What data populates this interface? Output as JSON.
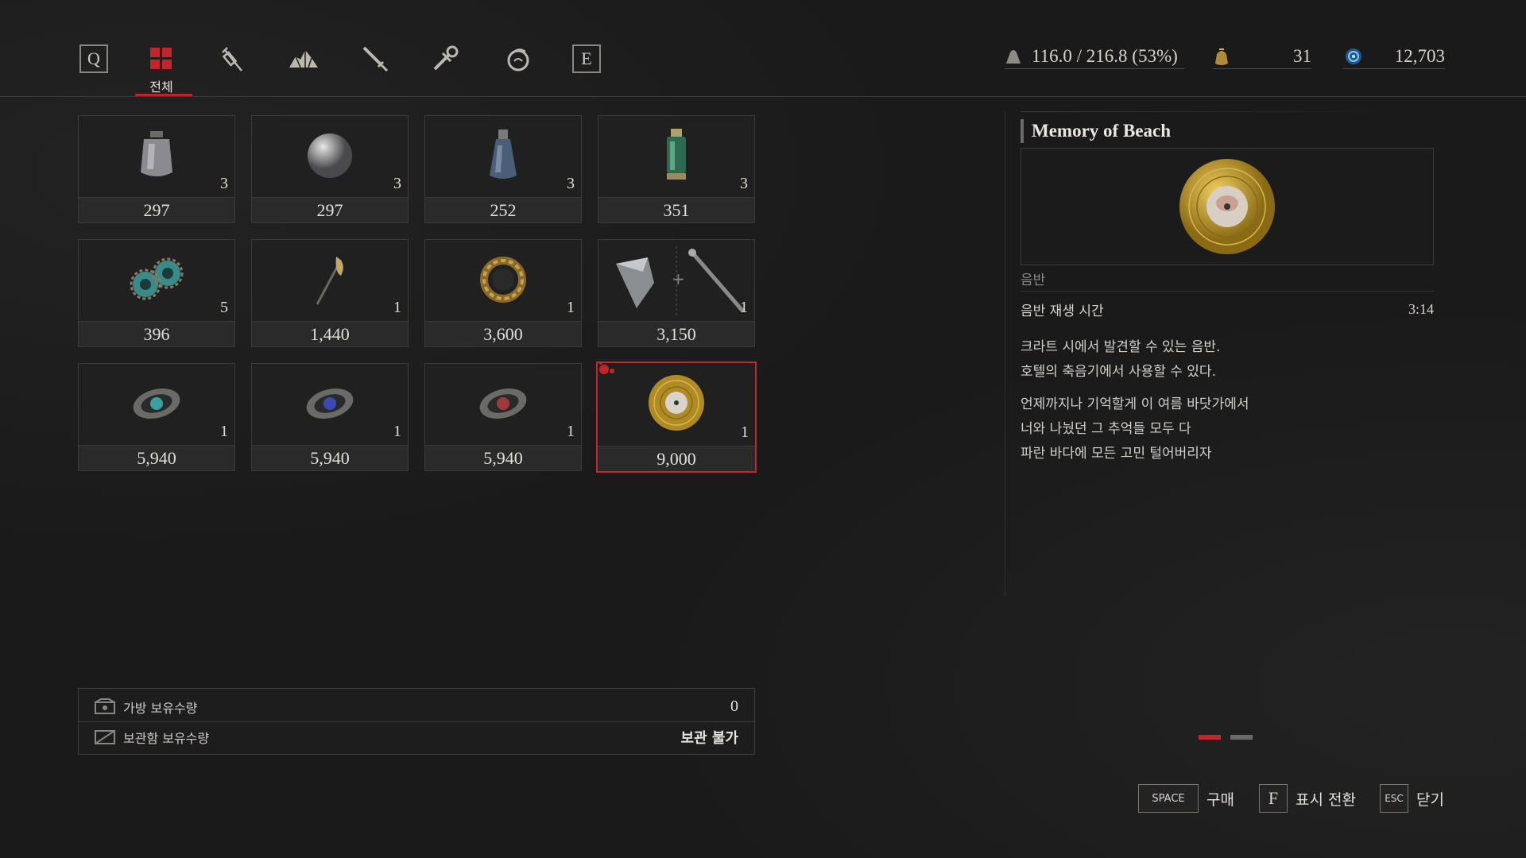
{
  "tabs": {
    "left_key": "Q",
    "right_key": "E",
    "active_label": "전체",
    "icons": [
      "all-grid-icon",
      "syringe-icon",
      "ore-pile-icon",
      "dagger-icon",
      "wrench-icon",
      "amulet-icon"
    ]
  },
  "stats": {
    "weight": "116.0 / 216.8 (53%)",
    "star_fragments": "31",
    "ergo": "12,703"
  },
  "items": [
    {
      "name": "lantern-flask",
      "qty": "3",
      "price": "297"
    },
    {
      "name": "grey-orb",
      "qty": "3",
      "price": "297"
    },
    {
      "name": "blue-bottle",
      "qty": "3",
      "price": "252"
    },
    {
      "name": "green-vial",
      "qty": "3",
      "price": "351"
    },
    {
      "name": "teal-gear",
      "qty": "5",
      "price": "396"
    },
    {
      "name": "quill-tool",
      "qty": "1",
      "price": "1,440"
    },
    {
      "name": "gold-ring",
      "qty": "1",
      "price": "3,600"
    },
    {
      "name": "blade-handle-combo",
      "qty": "1",
      "price": "3,150"
    },
    {
      "name": "teal-quartz",
      "qty": "1",
      "price": "5,940"
    },
    {
      "name": "blue-quartz",
      "qty": "1",
      "price": "5,940"
    },
    {
      "name": "red-quartz",
      "qty": "1",
      "price": "5,940"
    },
    {
      "name": "gold-record",
      "qty": "1",
      "price": "9,000"
    }
  ],
  "stock": {
    "bag_label": "가방 보유수량",
    "bag_value": "0",
    "storage_label": "보관함 보유수량",
    "storage_value": "보관 불가"
  },
  "detail": {
    "title": "Memory of Beach",
    "category": "음반",
    "attr_label": "음반 재생 시간",
    "attr_value": "3:14",
    "desc1": "크라트 시에서 발견할 수 있는 음반.",
    "desc2": "호텔의 축음기에서 사용할 수 있다.",
    "desc3": "언제까지나 기억할게 이 여름 바닷가에서",
    "desc4": "너와 나눴던 그 추억들 모두 다",
    "desc5": "파란 바다에 모든 고민 털어버리자"
  },
  "footer": {
    "space_key": "SPACE",
    "space_label": "구매",
    "f_key": "F",
    "f_label": "표시 전환",
    "esc_key": "ESC",
    "esc_label": "닫기"
  },
  "colors": {
    "accent": "#c0262c",
    "gold": "#c9a227"
  }
}
